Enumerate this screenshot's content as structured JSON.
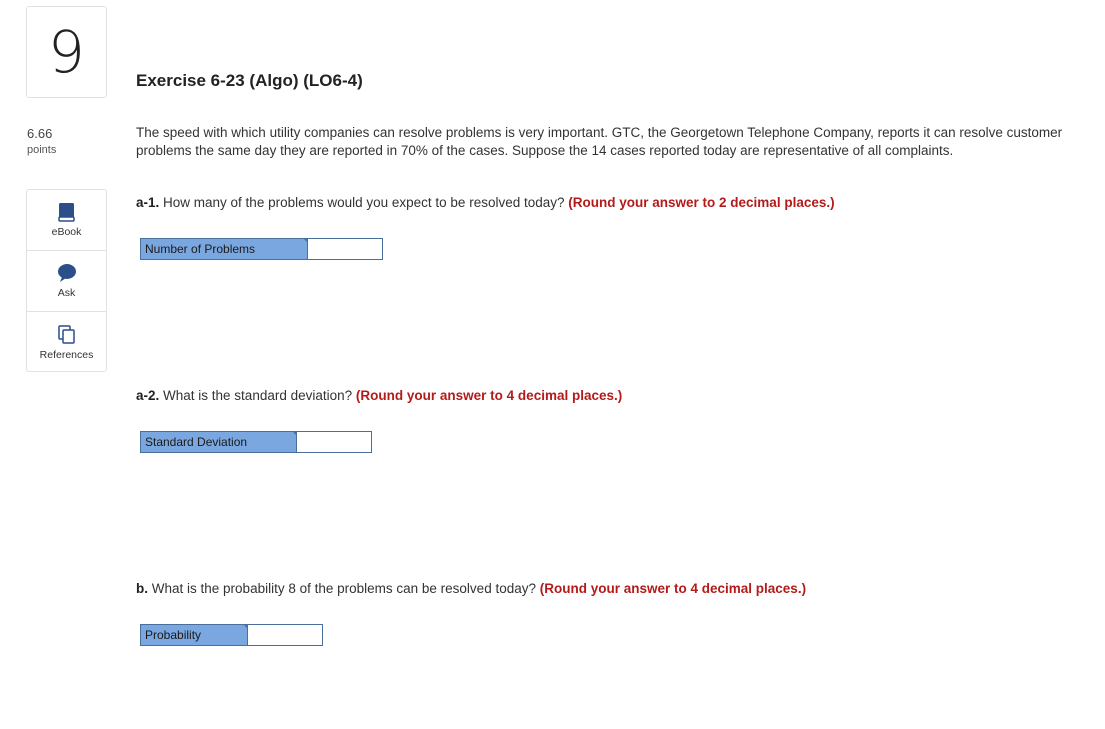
{
  "question": {
    "number": "9",
    "points_value": "6.66",
    "points_label": "points"
  },
  "tools": [
    {
      "label": "eBook",
      "icon": "book-icon"
    },
    {
      "label": "Ask",
      "icon": "chat-bubble-icon"
    },
    {
      "label": "References",
      "icon": "documents-icon"
    }
  ],
  "exercise": {
    "title": "Exercise 6-23 (Algo) (LO6-4)",
    "stem": "The speed with which utility companies can resolve problems is very important. GTC, the Georgetown Telephone Company, reports it can resolve customer problems the same day they are reported in 70% of the cases. Suppose the 14 cases reported today are representative of all complaints."
  },
  "parts": [
    {
      "part": "a-1.",
      "text": "How many of the problems would you expect to be resolved today?",
      "rounding": "(Round your answer to 2 decimal places.)",
      "answer_label": "Number of Problems",
      "answer_value": ""
    },
    {
      "part": "a-2.",
      "text": "What is the standard deviation?",
      "rounding": "(Round your answer to 4 decimal places.)",
      "answer_label": "Standard Deviation",
      "answer_value": ""
    },
    {
      "part": "b.",
      "text": "What is the probability 8 of the problems can be resolved today?",
      "rounding": "(Round your answer to 4 decimal places.)",
      "answer_label": "Probability",
      "answer_value": ""
    }
  ],
  "colors": {
    "accent_red": "#b31b1b",
    "label_fill": "#7aa7e0",
    "input_border": "#4a6f9a"
  }
}
